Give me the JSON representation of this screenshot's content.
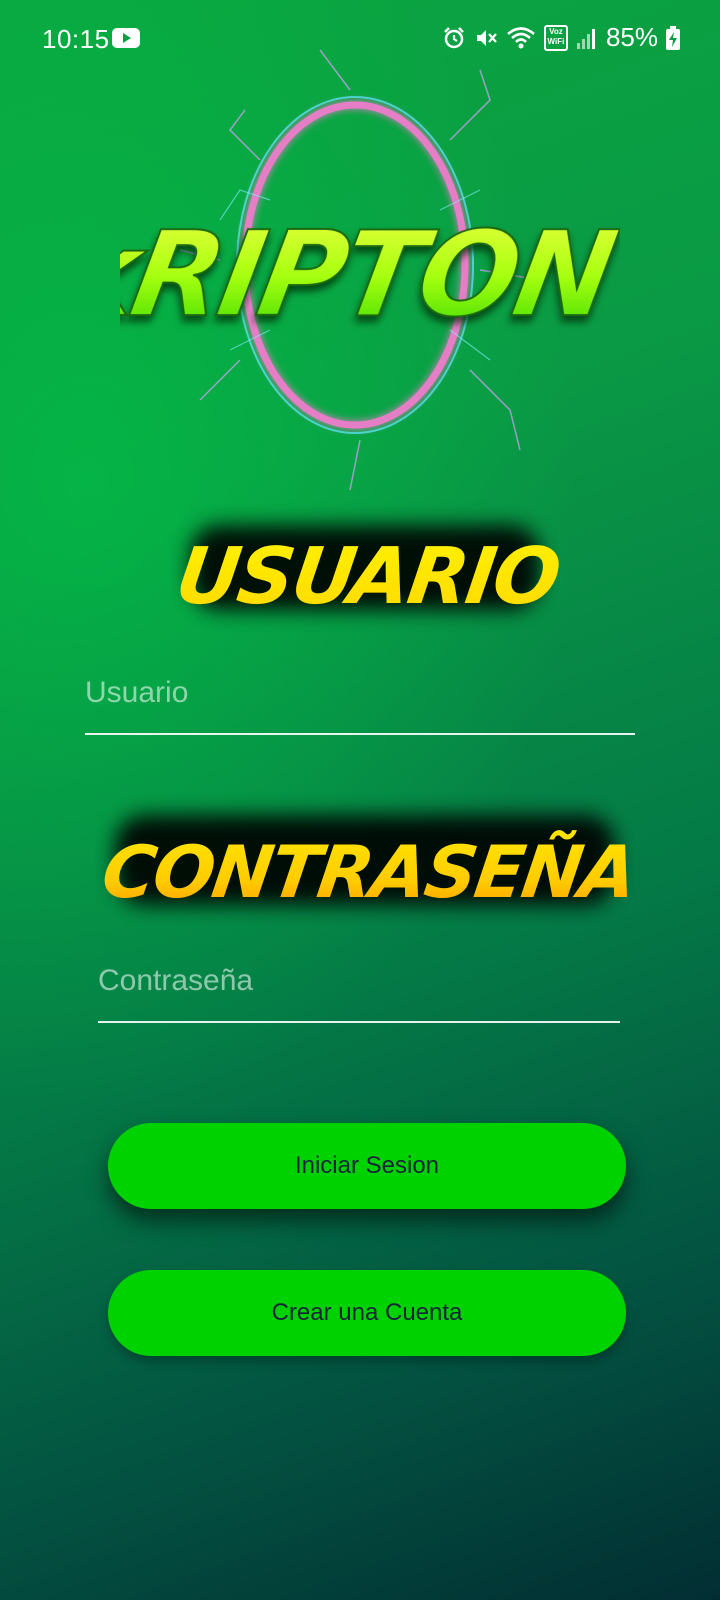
{
  "status_bar": {
    "time": "10:15",
    "battery": "85%",
    "wifi_call_label_top": "Voz",
    "wifi_call_label_bottom": "WiFi",
    "icons": [
      "youtube-icon",
      "alarm-icon",
      "mute-icon",
      "wifi-icon",
      "wifi-calling-icon",
      "signal-icon",
      "battery-charging-icon"
    ]
  },
  "app": {
    "logo_text": "kRIPTON"
  },
  "login_form": {
    "user_heading": "USUARIO",
    "user_placeholder": "Usuario",
    "password_heading": "CONTRASEÑA",
    "password_placeholder": "Contraseña",
    "login_button": "Iniciar Sesion",
    "create_account_button": "Crear una Cuenta"
  },
  "colors": {
    "button_green": "#00d200",
    "button_text": "#17233a",
    "logo_green": "#8cf000",
    "heading_yellow": "#ffe800",
    "ring_pink": "#ff7ad6"
  }
}
